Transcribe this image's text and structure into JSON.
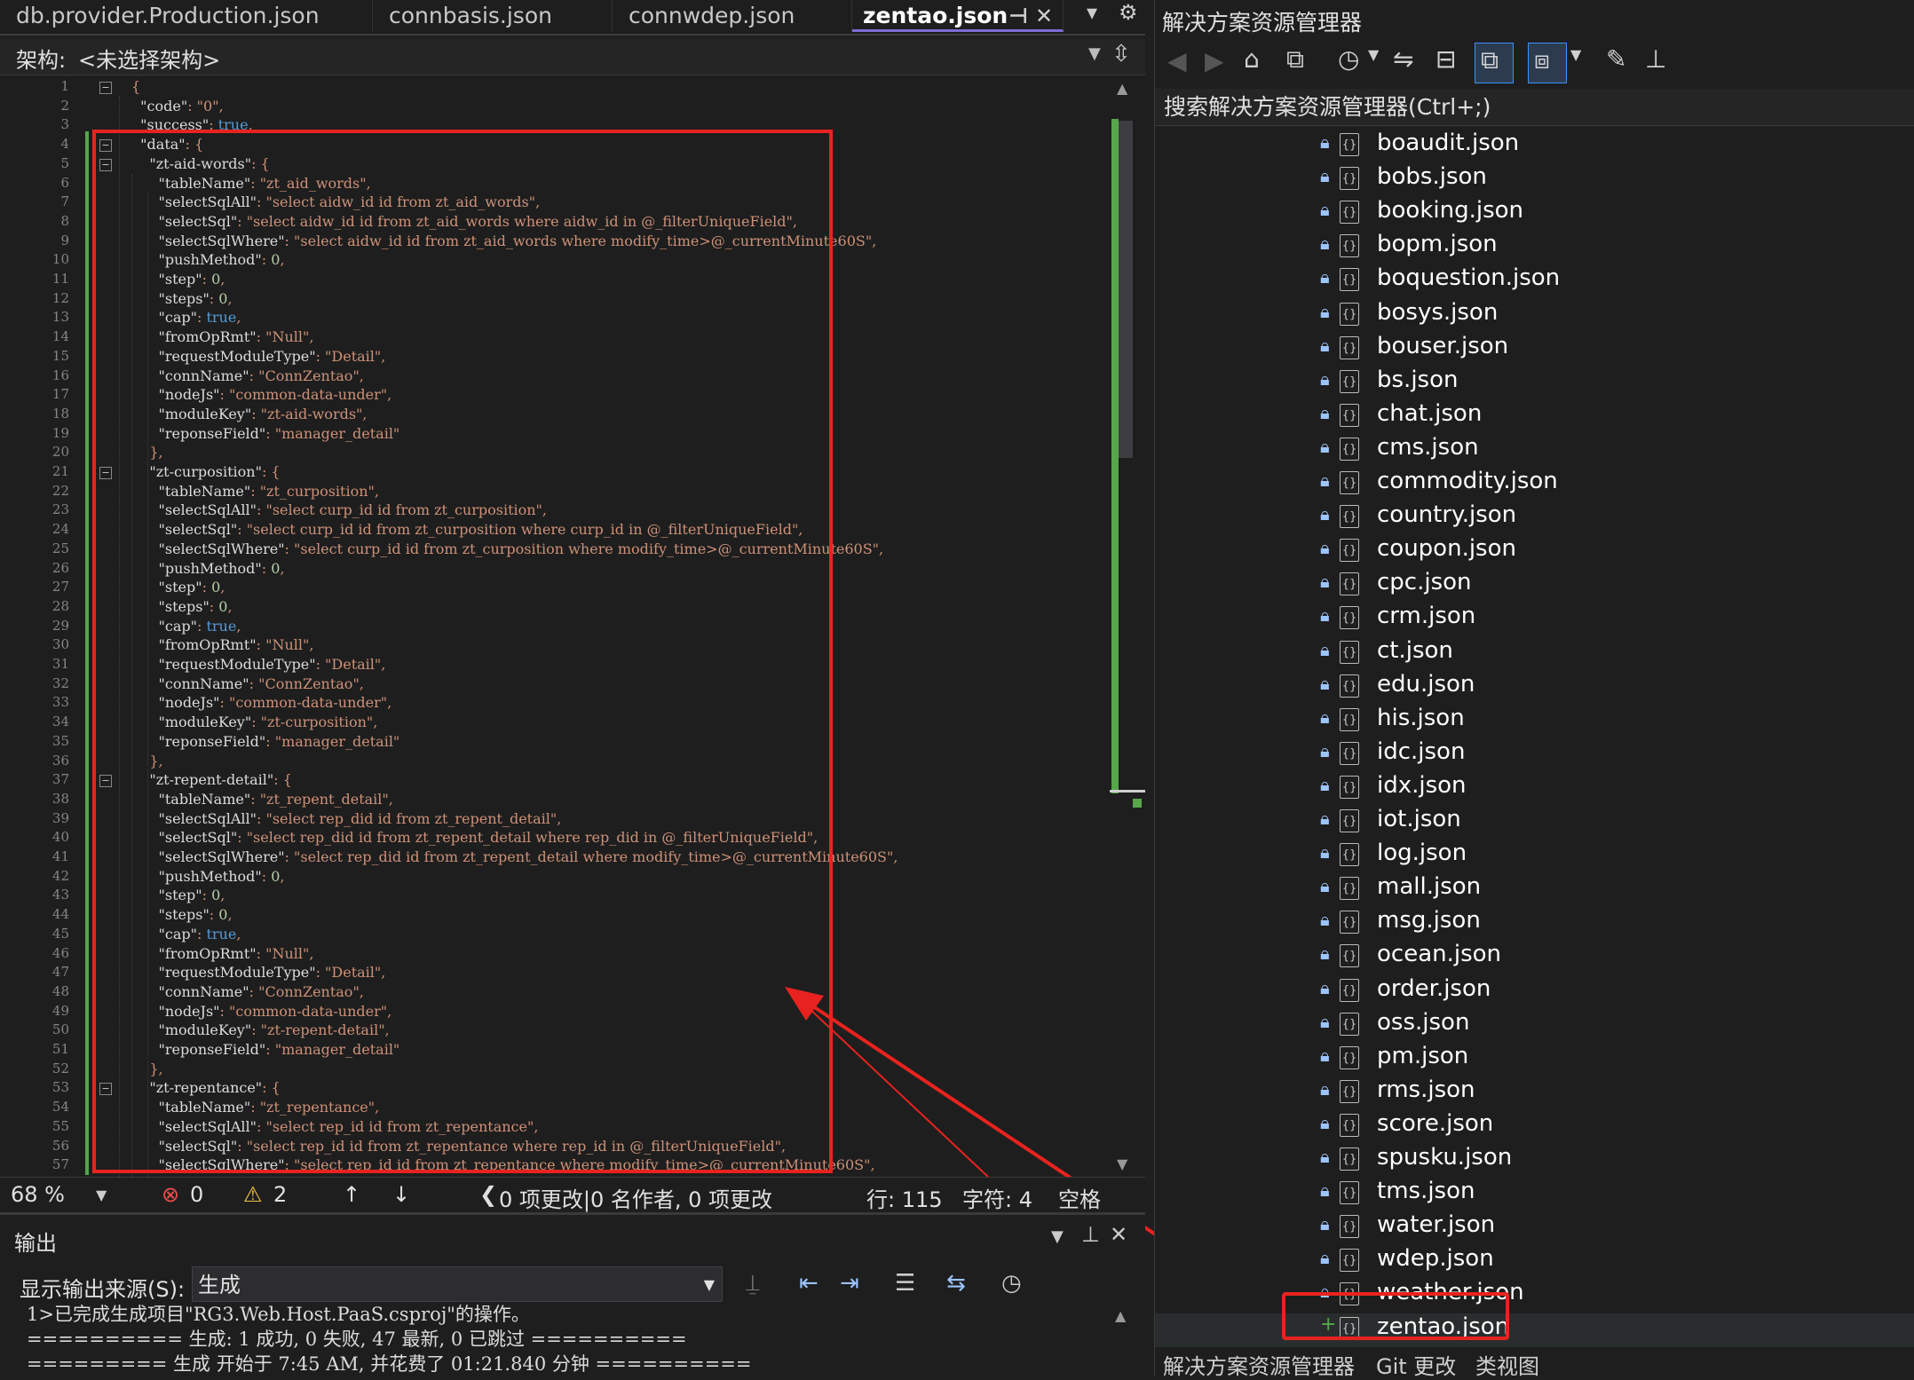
{
  "tabs": [
    {
      "label": "db.provider.Production.json",
      "active": false
    },
    {
      "label": "connbasis.json",
      "active": false
    },
    {
      "label": "connwdep.json",
      "active": false
    },
    {
      "label": "zentao.json",
      "active": true
    }
  ],
  "tab_icons": {
    "pin": "⊣",
    "close": "✕",
    "dropdown": "▾",
    "settings": "⚙"
  },
  "archbar": {
    "label": "架构:",
    "value": "<未选择架构>"
  },
  "code_lines": [
    {
      "n": "1",
      "text": "{"
    },
    {
      "n": "2",
      "text": "  \"code\": \"0\","
    },
    {
      "n": "3",
      "text": "  \"success\": true,"
    },
    {
      "n": "4",
      "text": "  \"data\": {"
    },
    {
      "n": "5",
      "text": "    \"zt-aid-words\": {"
    },
    {
      "n": "6",
      "text": "      \"tableName\": \"zt_aid_words\","
    },
    {
      "n": "7",
      "text": "      \"selectSqlAll\": \"select aidw_id id from zt_aid_words\","
    },
    {
      "n": "8",
      "text": "      \"selectSql\": \"select aidw_id id from zt_aid_words where aidw_id in @_filterUniqueField\","
    },
    {
      "n": "9",
      "text": "      \"selectSqlWhere\": \"select aidw_id id from zt_aid_words where modify_time>@_currentMinute60S\","
    },
    {
      "n": "10",
      "text": "      \"pushMethod\": 0,"
    },
    {
      "n": "11",
      "text": "      \"step\": 0,"
    },
    {
      "n": "12",
      "text": "      \"steps\": 0,"
    },
    {
      "n": "13",
      "text": "      \"cap\": true,"
    },
    {
      "n": "14",
      "text": "      \"fromOpRmt\": \"Null\","
    },
    {
      "n": "15",
      "text": "      \"requestModuleType\": \"Detail\","
    },
    {
      "n": "16",
      "text": "      \"connName\": \"ConnZentao\","
    },
    {
      "n": "17",
      "text": "      \"nodeJs\": \"common-data-under\","
    },
    {
      "n": "18",
      "text": "      \"moduleKey\": \"zt-aid-words\","
    },
    {
      "n": "19",
      "text": "      \"reponseField\": \"manager_detail\""
    },
    {
      "n": "20",
      "text": "    },"
    },
    {
      "n": "21",
      "text": "    \"zt-curposition\": {"
    },
    {
      "n": "22",
      "text": "      \"tableName\": \"zt_curposition\","
    },
    {
      "n": "23",
      "text": "      \"selectSqlAll\": \"select curp_id id from zt_curposition\","
    },
    {
      "n": "24",
      "text": "      \"selectSql\": \"select curp_id id from zt_curposition where curp_id in @_filterUniqueField\","
    },
    {
      "n": "25",
      "text": "      \"selectSqlWhere\": \"select curp_id id from zt_curposition where modify_time>@_currentMinute60S\","
    },
    {
      "n": "26",
      "text": "      \"pushMethod\": 0,"
    },
    {
      "n": "27",
      "text": "      \"step\": 0,"
    },
    {
      "n": "28",
      "text": "      \"steps\": 0,"
    },
    {
      "n": "29",
      "text": "      \"cap\": true,"
    },
    {
      "n": "30",
      "text": "      \"fromOpRmt\": \"Null\","
    },
    {
      "n": "31",
      "text": "      \"requestModuleType\": \"Detail\","
    },
    {
      "n": "32",
      "text": "      \"connName\": \"ConnZentao\","
    },
    {
      "n": "33",
      "text": "      \"nodeJs\": \"common-data-under\","
    },
    {
      "n": "34",
      "text": "      \"moduleKey\": \"zt-curposition\","
    },
    {
      "n": "35",
      "text": "      \"reponseField\": \"manager_detail\""
    },
    {
      "n": "36",
      "text": "    },"
    },
    {
      "n": "37",
      "text": "    \"zt-repent-detail\": {"
    },
    {
      "n": "38",
      "text": "      \"tableName\": \"zt_repent_detail\","
    },
    {
      "n": "39",
      "text": "      \"selectSqlAll\": \"select rep_did id from zt_repent_detail\","
    },
    {
      "n": "40",
      "text": "      \"selectSql\": \"select rep_did id from zt_repent_detail where rep_did in @_filterUniqueField\","
    },
    {
      "n": "41",
      "text": "      \"selectSqlWhere\": \"select rep_did id from zt_repent_detail where modify_time>@_currentMinute60S\","
    },
    {
      "n": "42",
      "text": "      \"pushMethod\": 0,"
    },
    {
      "n": "43",
      "text": "      \"step\": 0,"
    },
    {
      "n": "44",
      "text": "      \"steps\": 0,"
    },
    {
      "n": "45",
      "text": "      \"cap\": true,"
    },
    {
      "n": "46",
      "text": "      \"fromOpRmt\": \"Null\","
    },
    {
      "n": "47",
      "text": "      \"requestModuleType\": \"Detail\","
    },
    {
      "n": "48",
      "text": "      \"connName\": \"ConnZentao\","
    },
    {
      "n": "49",
      "text": "      \"nodeJs\": \"common-data-under\","
    },
    {
      "n": "50",
      "text": "      \"moduleKey\": \"zt-repent-detail\","
    },
    {
      "n": "51",
      "text": "      \"reponseField\": \"manager_detail\""
    },
    {
      "n": "52",
      "text": "    },"
    },
    {
      "n": "53",
      "text": "    \"zt-repentance\": {"
    },
    {
      "n": "54",
      "text": "      \"tableName\": \"zt_repentance\","
    },
    {
      "n": "55",
      "text": "      \"selectSqlAll\": \"select rep_id id from zt_repentance\","
    },
    {
      "n": "56",
      "text": "      \"selectSql\": \"select rep_id id from zt_repentance where rep_id in @_filterUniqueField\","
    },
    {
      "n": "57",
      "text": "      \"selectSqlWhere\": \"select rep_id id from zt_repentance where modify_time>@_currentMinute60S\","
    }
  ],
  "editor_status": {
    "zoom": "68 %",
    "errors": "0",
    "warnings": "2",
    "changes": "0 项更改|0 名作者, 0 项更改",
    "line": "行: 115",
    "char": "字符: 4",
    "spaces": "空格"
  },
  "output": {
    "title": "输出",
    "source_label": "显示输出来源(S):",
    "source_value": "生成",
    "lines": [
      "1>已完成生成项目\"RG3.Web.Host.PaaS.csproj\"的操作。",
      "========== 生成: 1 成功, 0 失败, 47 最新, 0 已跳过 ==========",
      "========= 生成 开始于 7:45 AM, 并花费了 01:21.840 分钟 =========="
    ]
  },
  "solution": {
    "title": "解决方案资源管理器",
    "search_placeholder": "搜索解决方案资源管理器(Ctrl+;)",
    "files": [
      "boaudit.json",
      "bobs.json",
      "booking.json",
      "bopm.json",
      "boquestion.json",
      "bosys.json",
      "bouser.json",
      "bs.json",
      "chat.json",
      "cms.json",
      "commodity.json",
      "country.json",
      "coupon.json",
      "cpc.json",
      "crm.json",
      "ct.json",
      "edu.json",
      "his.json",
      "idc.json",
      "idx.json",
      "iot.json",
      "log.json",
      "mall.json",
      "msg.json",
      "ocean.json",
      "order.json",
      "oss.json",
      "pm.json",
      "rms.json",
      "score.json",
      "spusku.json",
      "tms.json",
      "water.json",
      "wdep.json",
      "weather.json",
      "zentao.json"
    ],
    "bottom_tabs": [
      "解决方案资源管理器",
      "Git 更改",
      "类视图"
    ]
  },
  "colors": {
    "annotation": "#e8231f",
    "accent": "#7c6cd6",
    "added": "#57a64a"
  }
}
